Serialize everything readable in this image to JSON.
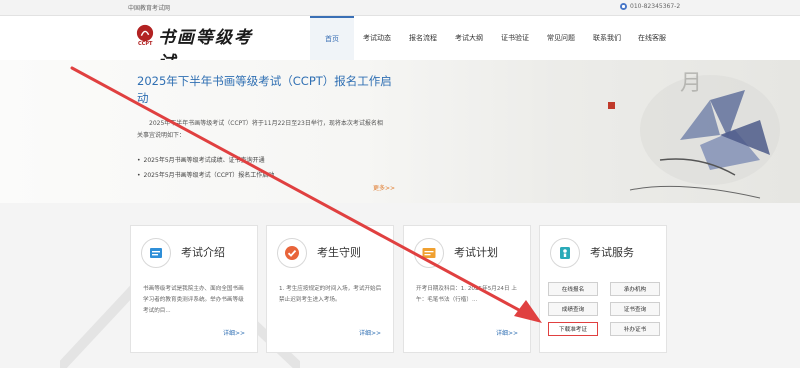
{
  "topbar": {
    "site": "中国教育考试网",
    "phone": "010-82345367-2"
  },
  "logo": {
    "brand": "书画等级考试",
    "sub": "CCPT"
  },
  "nav": {
    "items": [
      "首页",
      "考试动态",
      "报名流程",
      "考试大纲",
      "证书验证",
      "常见问题",
      "联系我们",
      "在线客服"
    ]
  },
  "banner": {
    "title": "2025年下半年书画等级考试（CCPT）报名工作启动",
    "desc": "2025年下半年书画等级考试（CCPT）将于11月22日至23日举行，现将本次考试报名相关事宜说明如下：",
    "news": [
      "2025年5月书画等级考试成绩、证书查询开通",
      "2025年5月书画等级考试（CCPT）报名工作启动"
    ],
    "more": "更多>>"
  },
  "cards": [
    {
      "title": "考试介绍",
      "body": "书画等级考试是我院主办、面向全国书画学习者的教育类测评系统。举办书画等级考试的目...",
      "more": "详细>>"
    },
    {
      "title": "考生守则",
      "body": "1. 考生应按规定的时间入场，考试开始后禁止迟到考生进入考场。",
      "more": "详细>>"
    },
    {
      "title": "考试计划",
      "body": "开考日期及科目：1. 2025年5月24日 上午：毛笔书法（行楷）...",
      "more": "详细>>"
    },
    {
      "title": "考试服务",
      "buttons": [
        "在线报名",
        "承办机构",
        "成绩查询",
        "证书查询",
        "下载准考证",
        "补办证书"
      ]
    }
  ],
  "colors": {
    "accent": "#2f6fb3",
    "annotation": "#e04040",
    "more": "#e07a2b"
  }
}
